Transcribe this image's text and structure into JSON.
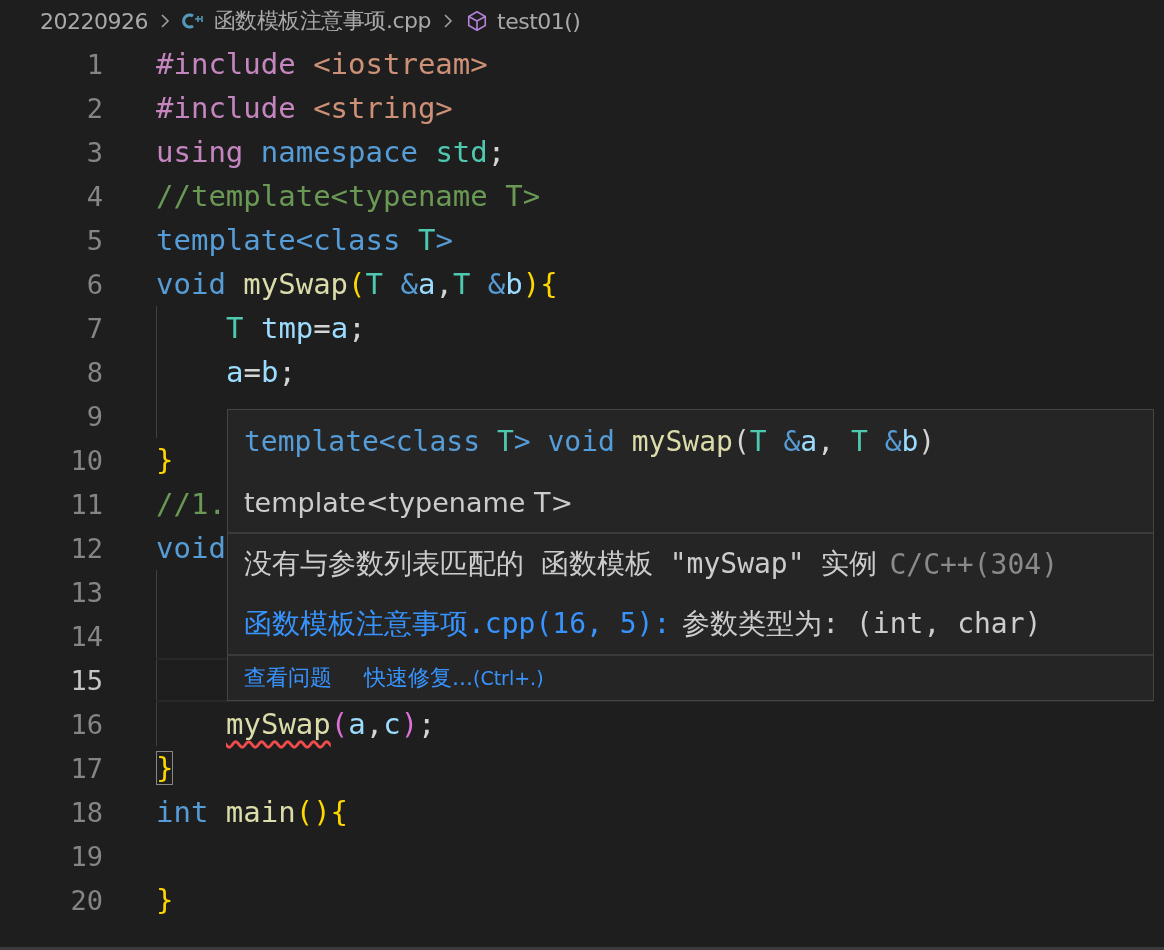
{
  "breadcrumb": {
    "folder": "20220926",
    "file": "函数模板注意事项.cpp",
    "symbol": "test01()"
  },
  "lines": [
    {
      "number": "1",
      "active": false,
      "guide": false,
      "tokens": [
        {
          "text": "#include ",
          "kind": "keyword"
        },
        {
          "text": "<iostream>",
          "kind": "string"
        }
      ]
    },
    {
      "number": "2",
      "active": false,
      "guide": false,
      "tokens": [
        {
          "text": "#include ",
          "kind": "keyword"
        },
        {
          "text": "<string>",
          "kind": "string"
        }
      ]
    },
    {
      "number": "3",
      "active": false,
      "guide": false,
      "tokens": [
        {
          "text": "using ",
          "kind": "keyword"
        },
        {
          "text": "namespace ",
          "kind": "storage"
        },
        {
          "text": "std",
          "kind": "type"
        },
        {
          "text": ";",
          "kind": "plain"
        }
      ]
    },
    {
      "number": "4",
      "active": false,
      "guide": false,
      "tokens": [
        {
          "text": "//template<typename T>",
          "kind": "comment"
        }
      ]
    },
    {
      "number": "5",
      "active": false,
      "guide": false,
      "tokens": [
        {
          "text": "template<class ",
          "kind": "storage"
        },
        {
          "text": "T",
          "kind": "type"
        },
        {
          "text": ">",
          "kind": "storage"
        }
      ]
    },
    {
      "number": "6",
      "active": false,
      "guide": false,
      "tokens": [
        {
          "text": "void ",
          "kind": "storage"
        },
        {
          "text": "mySwap",
          "kind": "function"
        },
        {
          "text": "(",
          "kind": "bracket"
        },
        {
          "text": "T ",
          "kind": "type"
        },
        {
          "text": "&",
          "kind": "storage"
        },
        {
          "text": "a",
          "kind": "variable"
        },
        {
          "text": ",",
          "kind": "plain"
        },
        {
          "text": "T ",
          "kind": "type"
        },
        {
          "text": "&",
          "kind": "storage"
        },
        {
          "text": "b",
          "kind": "variable"
        },
        {
          "text": ")",
          "kind": "bracket"
        },
        {
          "text": "{",
          "kind": "bracket"
        }
      ]
    },
    {
      "number": "7",
      "active": false,
      "guide": true,
      "tokens": [
        {
          "text": "T ",
          "kind": "type"
        },
        {
          "text": "tmp",
          "kind": "variable"
        },
        {
          "text": "=",
          "kind": "plain"
        },
        {
          "text": "a",
          "kind": "variable"
        },
        {
          "text": ";",
          "kind": "plain"
        }
      ]
    },
    {
      "number": "8",
      "active": false,
      "guide": true,
      "tokens": [
        {
          "text": "a",
          "kind": "variable"
        },
        {
          "text": "=",
          "kind": "plain"
        },
        {
          "text": "b",
          "kind": "variable"
        },
        {
          "text": ";",
          "kind": "plain"
        }
      ]
    },
    {
      "number": "9",
      "active": false,
      "guide": true
    },
    {
      "number": "10",
      "active": false,
      "guide": false,
      "tokens": [
        {
          "text": "}",
          "kind": "bracket"
        }
      ]
    },
    {
      "number": "11",
      "active": false,
      "guide": false,
      "tokens": [
        {
          "text": "//1.",
          "kind": "comment"
        }
      ]
    },
    {
      "number": "12",
      "active": false,
      "guide": false,
      "tokens": [
        {
          "text": "void",
          "kind": "storage"
        }
      ]
    },
    {
      "number": "13",
      "active": false,
      "guide": true
    },
    {
      "number": "14",
      "active": false,
      "guide": true
    },
    {
      "number": "15",
      "active": true,
      "guide": true
    },
    {
      "number": "16",
      "active": false,
      "guide": true,
      "tokens": [
        {
          "text": "mySwap",
          "kind": "function",
          "squiggle": true
        },
        {
          "text": "(",
          "kind": "bracket2"
        },
        {
          "text": "a",
          "kind": "variable"
        },
        {
          "text": ",",
          "kind": "plain"
        },
        {
          "text": "c",
          "kind": "variable"
        },
        {
          "text": ")",
          "kind": "bracket2"
        },
        {
          "text": ";",
          "kind": "plain"
        }
      ]
    },
    {
      "number": "17",
      "active": false,
      "guide": false,
      "tokens": [
        {
          "text": "}",
          "kind": "bracket-matched"
        }
      ]
    },
    {
      "number": "18",
      "active": false,
      "guide": false,
      "tokens": [
        {
          "text": "int ",
          "kind": "storage"
        },
        {
          "text": "main",
          "kind": "function"
        },
        {
          "text": "()",
          "kind": "bracket"
        },
        {
          "text": "{",
          "kind": "bracket"
        }
      ]
    },
    {
      "number": "19",
      "active": false,
      "guide": false
    },
    {
      "number": "20",
      "active": false,
      "guide": false,
      "tokens": [
        {
          "text": "}",
          "kind": "bracket"
        }
      ]
    }
  ],
  "hover": {
    "signature": [
      {
        "text": "template<class ",
        "kind": "storage"
      },
      {
        "text": "T",
        "kind": "type"
      },
      {
        "text": "> void ",
        "kind": "storage"
      },
      {
        "text": "mySwap",
        "kind": "function"
      },
      {
        "text": "(",
        "kind": "plain"
      },
      {
        "text": "T ",
        "kind": "type"
      },
      {
        "text": "&",
        "kind": "storage"
      },
      {
        "text": "a",
        "kind": "variable"
      },
      {
        "text": ", ",
        "kind": "plain"
      },
      {
        "text": "T ",
        "kind": "type"
      },
      {
        "text": "&",
        "kind": "storage"
      },
      {
        "text": "b",
        "kind": "variable"
      },
      {
        "text": ")",
        "kind": "plain"
      }
    ],
    "doc": "template<typename T>",
    "message": "没有与参数列表匹配的 函数模板 \"mySwap\" 实例",
    "source": "C/C++(304)",
    "location": "函数模板注意事项.cpp(16, 5):",
    "detail": "参数类型为: (int, char)",
    "actions": [
      {
        "label": "查看问题"
      },
      {
        "label": "快速修复...",
        "shortcut": "(Ctrl+.)"
      }
    ]
  }
}
